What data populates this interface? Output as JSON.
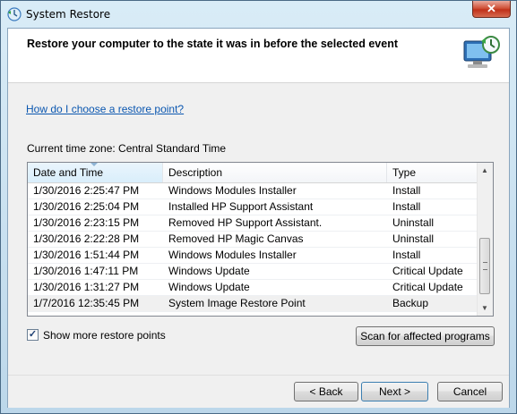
{
  "window": {
    "title": "System Restore",
    "close_label": "✕"
  },
  "header": {
    "title": "Restore your computer to the state it was in before the selected event"
  },
  "body": {
    "help_link": "How do I choose a restore point?",
    "timezone_label": "Current time zone: Central Standard Time"
  },
  "list": {
    "columns": {
      "date": "Date and Time",
      "description": "Description",
      "type": "Type"
    },
    "rows": [
      {
        "date": "1/30/2016 2:25:47 PM",
        "description": "Windows Modules Installer",
        "type": "Install"
      },
      {
        "date": "1/30/2016 2:25:04 PM",
        "description": "Installed HP Support Assistant",
        "type": "Install"
      },
      {
        "date": "1/30/2016 2:23:15 PM",
        "description": "Removed HP Support Assistant.",
        "type": "Uninstall"
      },
      {
        "date": "1/30/2016 2:22:28 PM",
        "description": "Removed HP Magic Canvas",
        "type": "Uninstall"
      },
      {
        "date": "1/30/2016 1:51:44 PM",
        "description": "Windows Modules Installer",
        "type": "Install"
      },
      {
        "date": "1/30/2016 1:47:11 PM",
        "description": "Windows Update",
        "type": "Critical Update"
      },
      {
        "date": "1/30/2016 1:31:27 PM",
        "description": "Windows Update",
        "type": "Critical Update"
      },
      {
        "date": "1/7/2016 12:35:45 PM",
        "description": "System Image Restore Point",
        "type": "Backup"
      }
    ]
  },
  "options": {
    "show_more_label": "Show more restore points",
    "show_more_checked": true,
    "scan_button": "Scan for affected programs"
  },
  "footer": {
    "back": "< Back",
    "next": "Next >",
    "cancel": "Cancel"
  },
  "icons": {
    "app": "system-restore-icon",
    "header": "computer-restore-icon"
  },
  "colors": {
    "link": "#0b57b0",
    "close_button": "#c0311a"
  }
}
